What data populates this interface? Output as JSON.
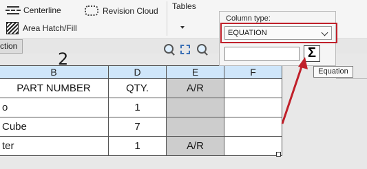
{
  "ribbon": {
    "centerline_label": "Centerline",
    "revision_cloud_label": "Revision Cloud",
    "area_hatch_label": "Area Hatch/Fill",
    "tables_label": "Tables"
  },
  "tab": {
    "label": "ction"
  },
  "sheet": {
    "balloon_digit": "2"
  },
  "table": {
    "headers": [
      "B",
      "D",
      "E",
      "F"
    ],
    "rows": [
      {
        "b": "PART NUMBER",
        "d": "QTY.",
        "e": "A/R",
        "f": ""
      },
      {
        "b": "o",
        "d": "1",
        "e": "",
        "f": ""
      },
      {
        "b": "Cube",
        "d": "7",
        "e": "",
        "f": ""
      },
      {
        "b": "ter",
        "d": "1",
        "e": "A/R",
        "f": ""
      }
    ]
  },
  "column_panel": {
    "label": "Column type:",
    "selected_type": "EQUATION",
    "formula_value": "",
    "equation_button_glyph": "Σ",
    "tooltip": "Equation"
  },
  "colors": {
    "header_fill": "#cfe6fa",
    "highlight_red": "#c0202a",
    "selected_cell_gray": "#cdcdcd"
  }
}
